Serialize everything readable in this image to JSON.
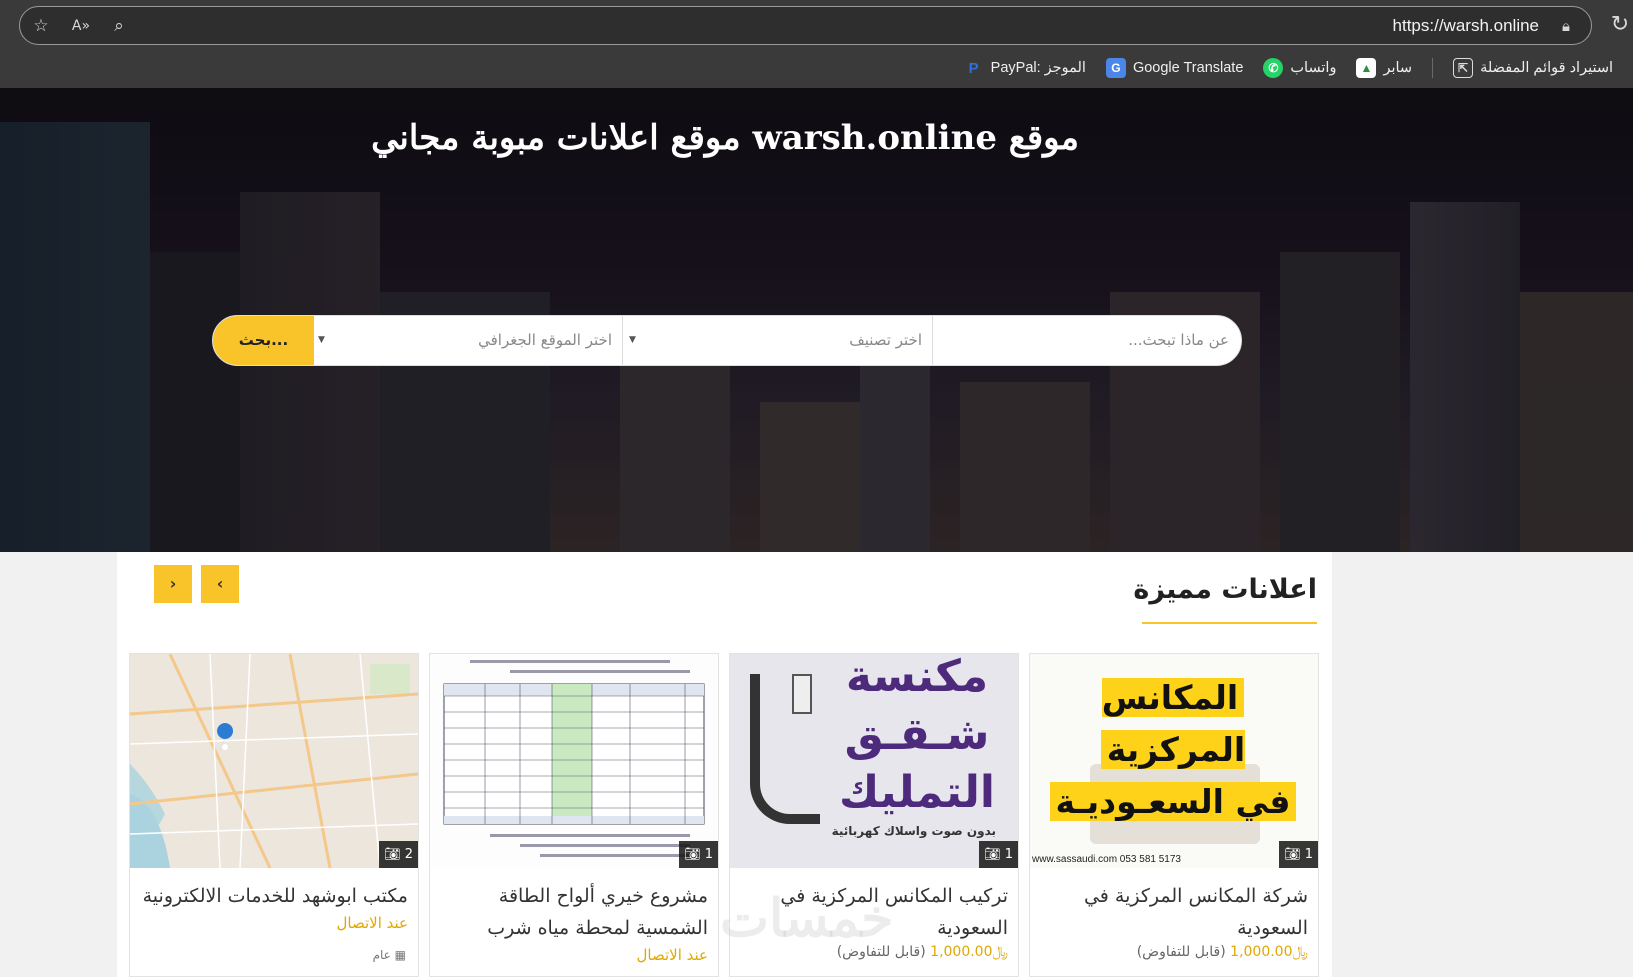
{
  "browser": {
    "url": "https://warsh.online",
    "bookmarks": [
      {
        "label": "استيراد قوائم المفضلة",
        "icon": "import-icon"
      },
      {
        "label": "سابر",
        "icon": "saber-icon"
      },
      {
        "label": "واتساب",
        "icon": "whatsapp-icon"
      },
      {
        "label": "Google Translate",
        "icon": "google-translate-icon"
      },
      {
        "label": "PayPal: الموجز",
        "icon": "paypal-icon"
      }
    ]
  },
  "hero": {
    "title": "موقع warsh.online موقع اعلانات مبوبة مجاني"
  },
  "search": {
    "what_placeholder": "عن ماذا تبحث...",
    "category_placeholder": "اختر تصنيف",
    "location_placeholder": "اختر الموقع الجغرافي",
    "button_label": "بحث..."
  },
  "featured": {
    "title": "اعلانات مميزة",
    "prev_label": "‹",
    "next_label": "›",
    "cards": [
      {
        "title": "شركة المكانس المركزية في السعودية",
        "photos": "1",
        "price": "1,000.00",
        "currency": "﷼",
        "price_note": "(قابل للتفاوض)",
        "thumb_text": [
          "المكانس المركزية",
          "في السعـوديـة"
        ],
        "thumb_footer": "www.sassaudi.com   053 581 5173"
      },
      {
        "title": "تركيب المكانس المركزية في السعودية",
        "photos": "1",
        "price": "1,000.00",
        "currency": "﷼",
        "price_note": "(قابل للتفاوض)",
        "thumb_text": [
          "مكنسة",
          "شـقـق",
          "التمليك"
        ],
        "thumb_footer": "بدون صوت واسلاك كهربائية"
      },
      {
        "title": "مشروع خيري ألواح الطاقة الشمسية لمحطة مياه شرب",
        "photos": "1",
        "contact": "عند الاتصال"
      },
      {
        "title": "مكتب ابوشهد للخدمات الالكترونية",
        "photos": "2",
        "contact": "عند الاتصال",
        "category": "عام"
      }
    ]
  },
  "watermark": "خمسات"
}
